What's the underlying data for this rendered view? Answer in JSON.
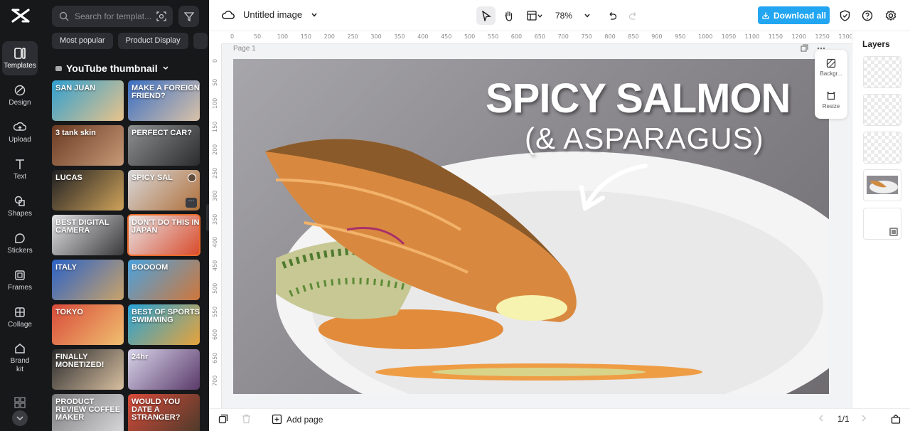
{
  "rail": {
    "items": [
      {
        "label": "Templates",
        "icon": "templates-icon",
        "active": true
      },
      {
        "label": "Design",
        "icon": "design-icon"
      },
      {
        "label": "Upload",
        "icon": "upload-icon"
      },
      {
        "label": "Text",
        "icon": "text-icon"
      },
      {
        "label": "Shapes",
        "icon": "shapes-icon"
      },
      {
        "label": "Stickers",
        "icon": "stickers-icon"
      },
      {
        "label": "Frames",
        "icon": "frames-icon"
      },
      {
        "label": "Collage",
        "icon": "collage-icon"
      },
      {
        "label": "Brand kit",
        "icon": "brand-kit-icon"
      }
    ]
  },
  "panel": {
    "search_placeholder": "Search for templat...",
    "chips": [
      "Most popular",
      "Product Display"
    ],
    "section_title": "YouTube thumbnail",
    "thumbnails": [
      {
        "text": "SAN JUAN",
        "colors": [
          "#2f9fd0",
          "#e9c38a"
        ]
      },
      {
        "text": "MAKE A FOREIGN FRIEND?",
        "colors": [
          "#3a6fc4",
          "#d9c2a8"
        ]
      },
      {
        "text": "3 tank skin",
        "colors": [
          "#6a3a22",
          "#c79a78"
        ]
      },
      {
        "text": "PERFECT CAR?",
        "colors": [
          "#8d8f91",
          "#2b2c2e"
        ]
      },
      {
        "text": "LUCAS",
        "colors": [
          "#1f1f22",
          "#cfa35a"
        ]
      },
      {
        "text": "SPICY SAL",
        "colors": [
          "#d8d8da",
          "#b0703a"
        ]
      },
      {
        "text": "BEST DIGITAL CAMERA",
        "colors": [
          "#e2e2e4",
          "#3a3a3c"
        ]
      },
      {
        "text": "DON'T DO THIS IN JAPAN",
        "colors": [
          "#e8e8ea",
          "#d94a2a"
        ]
      },
      {
        "text": "ITALY",
        "colors": [
          "#2a62c8",
          "#c9a36a"
        ]
      },
      {
        "text": "BOOOOM",
        "colors": [
          "#4aa3e0",
          "#d0773a"
        ]
      },
      {
        "text": "TOKYO",
        "colors": [
          "#d84a3a",
          "#f0c070"
        ]
      },
      {
        "text": "BEST OF SPORTS SWIMMING",
        "colors": [
          "#25a3d8",
          "#e8a33a"
        ]
      },
      {
        "text": "FINALLY MONETIZED!",
        "colors": [
          "#2a2a2c",
          "#d8c0a0"
        ]
      },
      {
        "text": "24hr",
        "colors": [
          "#d8d4ea",
          "#5a3a6a"
        ]
      },
      {
        "text": "PRODUCT REVIEW COFFEE MAKER",
        "colors": [
          "#7a7a7c",
          "#d9d9db"
        ]
      },
      {
        "text": "WOULD YOU DATE A STRANGER?",
        "colors": [
          "#d84a3a",
          "#4a3a2a"
        ]
      }
    ]
  },
  "topbar": {
    "doc_title": "Untitled image",
    "zoom": "78%",
    "download_label": "Download all"
  },
  "ruler": {
    "top": [
      "0",
      "50",
      "100",
      "150",
      "200",
      "250",
      "300",
      "350",
      "400",
      "450",
      "500",
      "550",
      "600",
      "650",
      "700",
      "750",
      "800",
      "850",
      "900",
      "950",
      "1000",
      "1050",
      "1100",
      "1150",
      "1200",
      "1250",
      "1300"
    ],
    "left": [
      "0",
      "50",
      "100",
      "150",
      "200",
      "250",
      "300",
      "350",
      "400",
      "450",
      "500",
      "550",
      "600",
      "650",
      "700"
    ]
  },
  "canvas": {
    "page_label": "Page 1",
    "title": "SPICY SALMON",
    "subtitle": "(& ASPARAGUS)",
    "float_tools": [
      "Backgr...",
      "Resize"
    ]
  },
  "layers": {
    "title": "Layers",
    "count": 5
  },
  "bottombar": {
    "add_page": "Add page",
    "page_counter": "1/1"
  }
}
